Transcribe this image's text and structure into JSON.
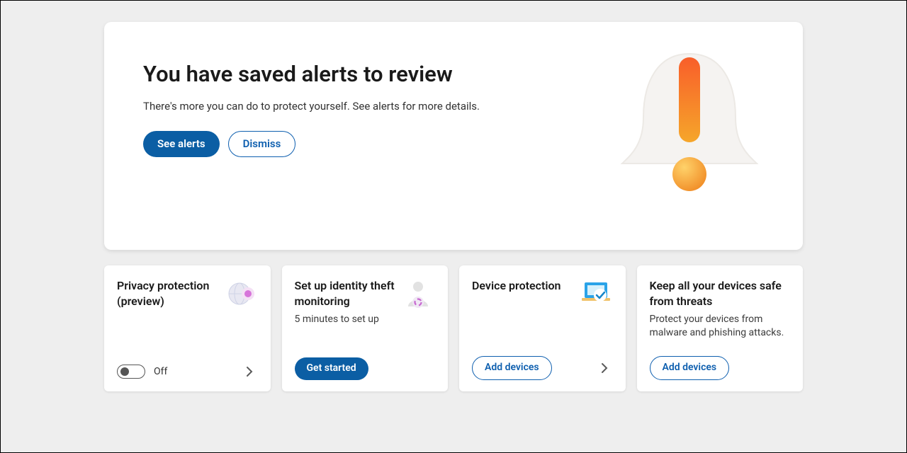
{
  "hero": {
    "title": "You have saved alerts to review",
    "subtitle": "There's more you can do to protect yourself. See alerts for more details.",
    "primary_button": "See alerts",
    "secondary_button": "Dismiss"
  },
  "cards": [
    {
      "title": "Privacy protection (preview)",
      "subtitle": "",
      "toggle_state": "Off",
      "has_chevron": true
    },
    {
      "title": "Set up identity theft monitoring",
      "subtitle": "5 minutes to set up",
      "button": "Get started",
      "button_style": "primary"
    },
    {
      "title": "Device protection",
      "subtitle": "",
      "button": "Add devices",
      "button_style": "secondary",
      "has_chevron": true
    },
    {
      "title": "Keep all your devices safe from threats",
      "subtitle": "Protect your devices from malware and phishing attacks.",
      "button": "Add devices",
      "button_style": "secondary"
    }
  ]
}
